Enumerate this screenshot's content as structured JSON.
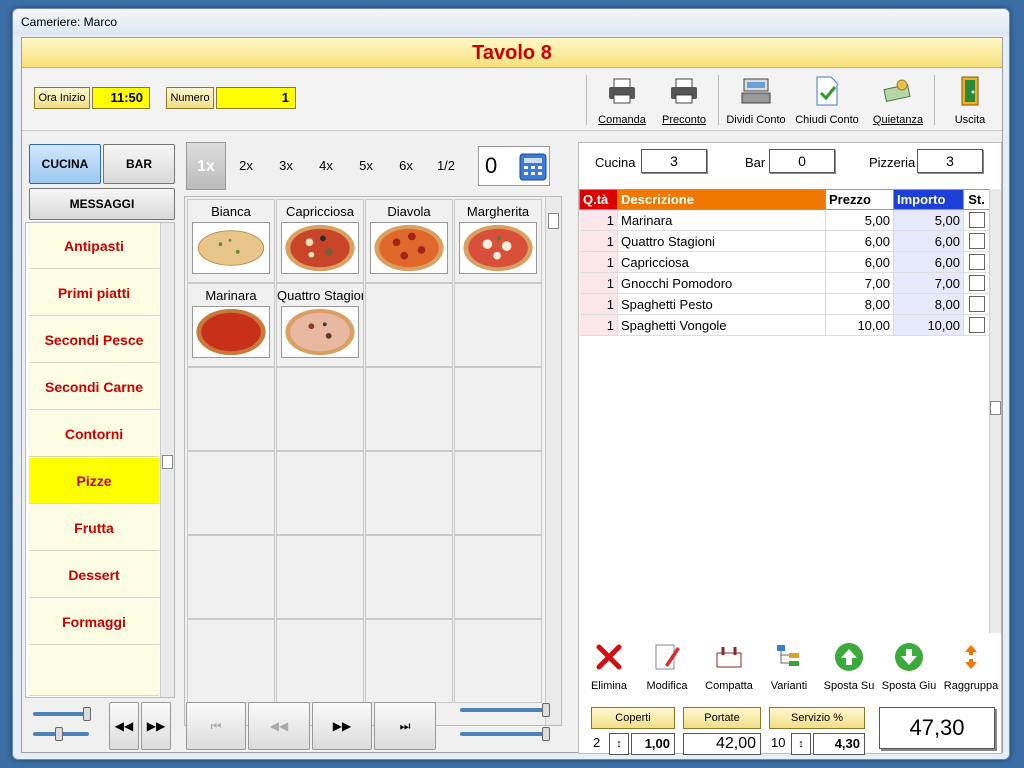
{
  "window": {
    "title": "Cameriere: Marco"
  },
  "table_title": "Tavolo 8",
  "header": {
    "ora_inizio_label": "Ora Inizio",
    "ora_inizio_value": "11:50",
    "numero_label": "Numero",
    "numero_value": "1"
  },
  "toolbar": {
    "comanda": "Comanda",
    "preconto": "Preconto",
    "dividi": "Dividi Conto",
    "chiudi": "Chiudi Conto",
    "quietanza": "Quietanza",
    "uscita": "Uscita"
  },
  "tabs": {
    "cucina": "CUCINA",
    "bar": "BAR",
    "messaggi": "MESSAGGI"
  },
  "categories": [
    "Antipasti",
    "Primi piatti",
    "Secondi Pesce",
    "Secondi Carne",
    "Contorni",
    "Pizze",
    "Frutta",
    "Dessert",
    "Formaggi"
  ],
  "qty_buttons": [
    "1x",
    "2x",
    "3x",
    "4x",
    "5x",
    "6x",
    "1/2"
  ],
  "qty_value": "0",
  "products": [
    "Bianca",
    "Capricciosa",
    "Diavola",
    "Margherita",
    "Marinara",
    "Quattro Stagioni"
  ],
  "counters": {
    "cucina_label": "Cucina",
    "cucina_value": "3",
    "bar_label": "Bar",
    "bar_value": "0",
    "pizzeria_label": "Pizzeria",
    "pizzeria_value": "3"
  },
  "order_headers": {
    "qta": "Q.tà",
    "descrizione": "Descrizione",
    "prezzo": "Prezzo",
    "importo": "Importo",
    "st": "St."
  },
  "orders": [
    {
      "qta": "1",
      "desc": "Marinara",
      "prezzo": "5,00",
      "importo": "5,00"
    },
    {
      "qta": "1",
      "desc": "Quattro Stagioni",
      "prezzo": "6,00",
      "importo": "6,00"
    },
    {
      "qta": "1",
      "desc": "Capricciosa",
      "prezzo": "6,00",
      "importo": "6,00"
    },
    {
      "qta": "1",
      "desc": "Gnocchi Pomodoro",
      "prezzo": "7,00",
      "importo": "7,00"
    },
    {
      "qta": "1",
      "desc": "Spaghetti Pesto",
      "prezzo": "8,00",
      "importo": "8,00"
    },
    {
      "qta": "1",
      "desc": "Spaghetti Vongole",
      "prezzo": "10,00",
      "importo": "10,00"
    }
  ],
  "actions": {
    "elimina": "Elimina",
    "modifica": "Modifica",
    "compatta": "Compatta",
    "varianti": "Varianti",
    "sposta_su": "Sposta Su",
    "sposta_giu": "Sposta Giu",
    "raggruppa": "Raggruppa"
  },
  "footer": {
    "coperti_label": "Coperti",
    "coperti_count": "2",
    "coperti_value": "1,00",
    "portate_label": "Portate",
    "portate_value": "42,00",
    "servizio_label": "Servizio %",
    "servizio_pct": "10",
    "servizio_value": "4,30",
    "totale": "47,30"
  },
  "colors": {
    "accent_red": "#cc0000",
    "category_yellow": "#ffff00",
    "header_orange": "#f07800",
    "header_blue": "#1c3fd8"
  }
}
